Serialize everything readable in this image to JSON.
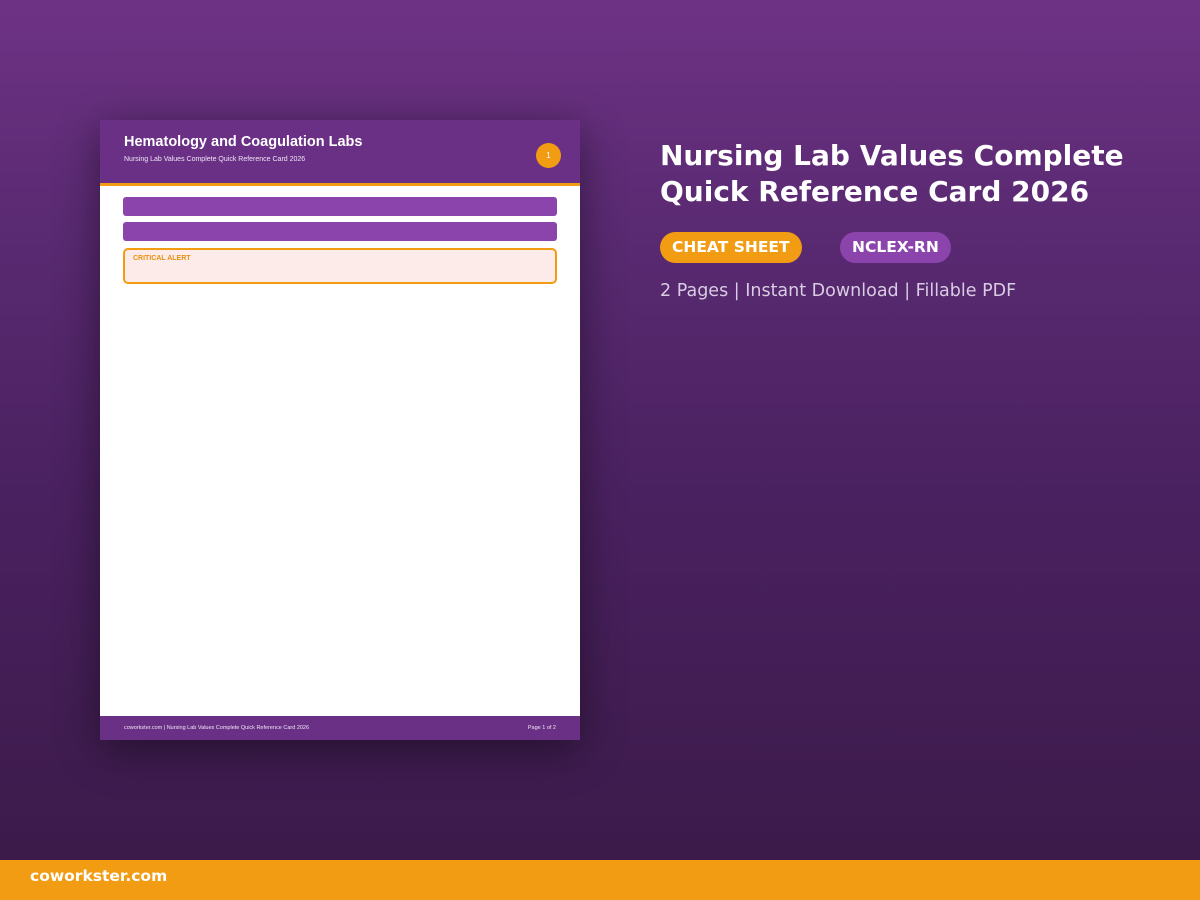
{
  "document_preview": {
    "title": "Hematology and Coagulation Labs",
    "subtitle": "Nursing Lab Values Complete Quick Reference Card 2026",
    "page_number": "1",
    "alert_label": "CRITICAL ALERT",
    "footer_left": "coworkster.com | Nursing Lab Values Complete Quick Reference Card 2026",
    "footer_right": "Page 1 of 2"
  },
  "product": {
    "title": "Nursing Lab Values Complete Quick Reference Card 2026",
    "tags": [
      "CHEAT SHEET",
      "NCLEX-RN"
    ],
    "meta": "2 Pages | Instant Download | Fillable PDF"
  },
  "brand": {
    "name": "coworkster.com"
  },
  "colors": {
    "accent_orange": "#f29c13",
    "primary_purple": "#6a3086",
    "secondary_purple": "#8c44ad",
    "alert_background": "#fcebe9"
  }
}
